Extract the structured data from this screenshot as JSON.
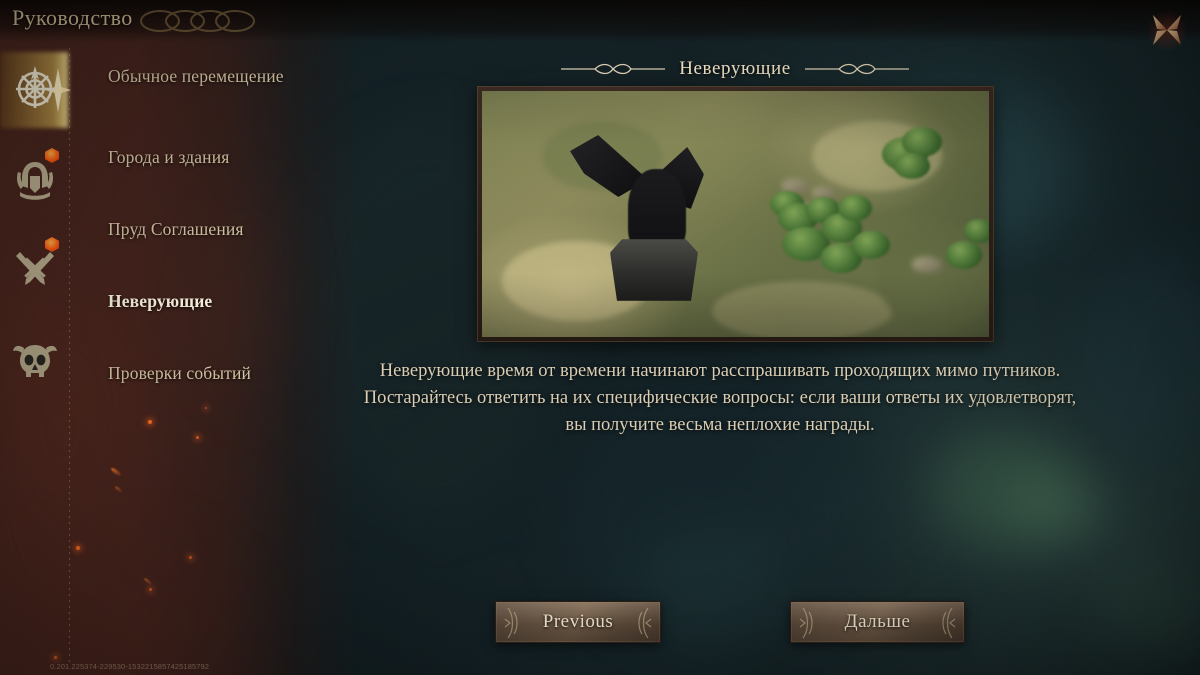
{
  "header": {
    "app_title": "Руководство",
    "close_label": "×"
  },
  "sidebar": {
    "icons": [
      {
        "name": "compass-rose-icon",
        "active": true,
        "badge": false
      },
      {
        "name": "winged-helmet-icon",
        "active": false,
        "badge": true
      },
      {
        "name": "crossed-swords-icon",
        "active": false,
        "badge": true
      },
      {
        "name": "horned-skull-icon",
        "active": false,
        "badge": false
      }
    ],
    "items": [
      {
        "label": "Обычное перемещение",
        "active": false
      },
      {
        "label": "Города и здания",
        "active": false
      },
      {
        "label": "Пруд Соглашения",
        "active": false
      },
      {
        "label": "Неверующие",
        "active": true
      },
      {
        "label": "Проверки событий",
        "active": false
      }
    ]
  },
  "content": {
    "panel_title": "Неверующие",
    "image_alt": "Тёмная крылатая статуя на каменном постаменте среди травы и деревьев",
    "description": "Неверующие время от времени начинают расспрашивать проходящих мимо путников. Постарайтесь ответить на их специфические вопросы: если ваши ответы их удовлетворят, вы получите весьма неплохие награды."
  },
  "footer": {
    "previous_label": "Previous",
    "next_label": "Дальше",
    "build_id": "0.201.225374-229530-1532215857425185792"
  },
  "colors": {
    "gold_accent": "#e8c45c",
    "text_primary": "#d8c7a6",
    "text_active": "#fff6e2",
    "badge_orange": "#ff5a12",
    "panel_red": "#4c261e",
    "button_brown": "#8a7158"
  }
}
